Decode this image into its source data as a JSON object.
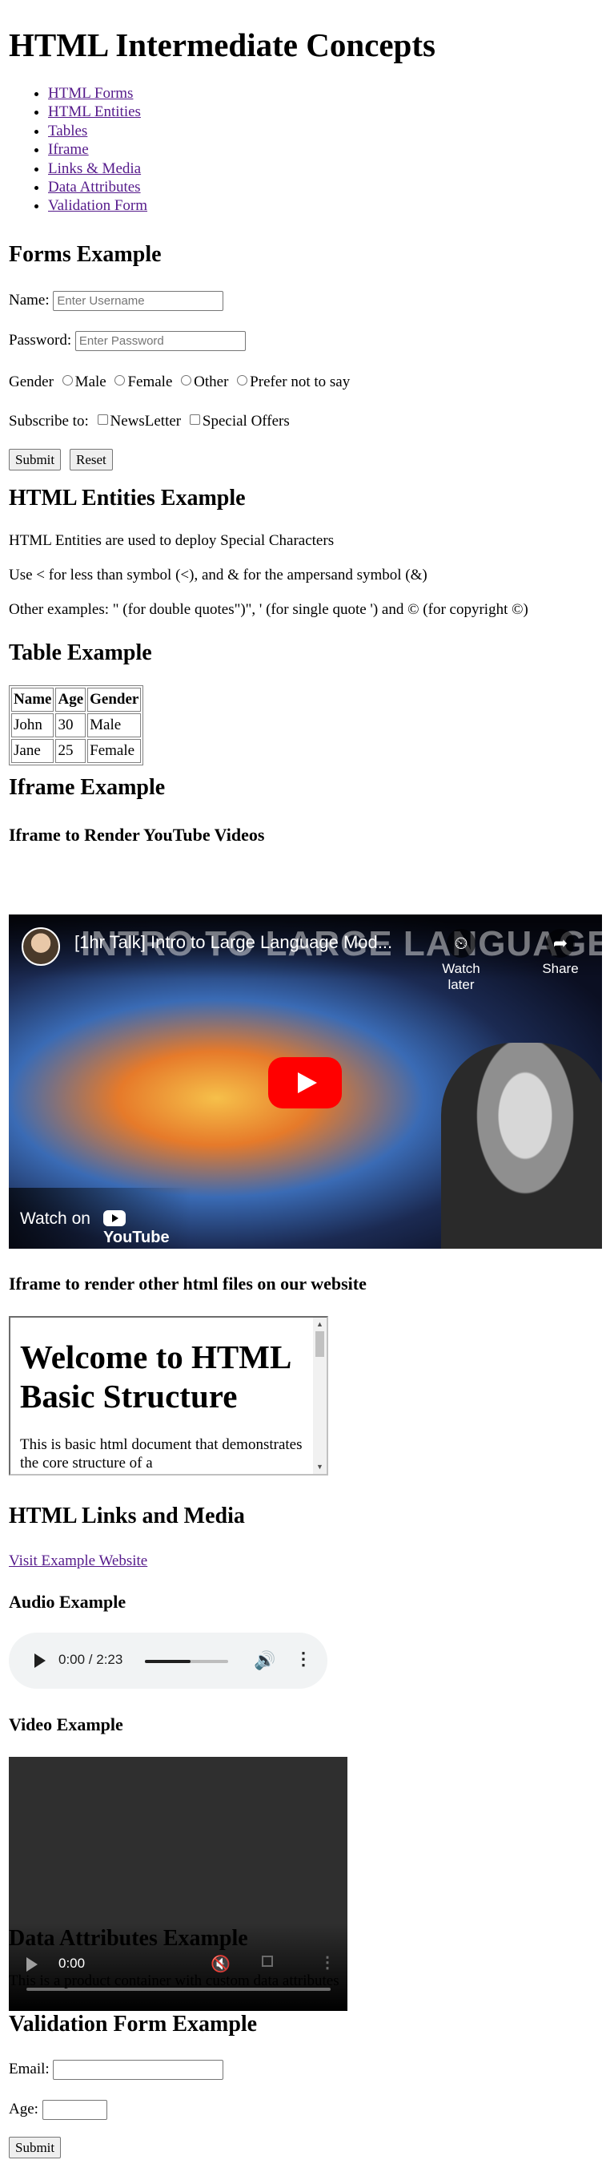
{
  "page_title": "HTML Intermediate Concepts",
  "nav": {
    "items": [
      {
        "label": "HTML Forms"
      },
      {
        "label": "HTML Entities"
      },
      {
        "label": "Tables"
      },
      {
        "label": "Iframe"
      },
      {
        "label": "Links & Media"
      },
      {
        "label": "Data Attributes"
      },
      {
        "label": "Validation Form"
      }
    ]
  },
  "forms": {
    "heading": "Forms Example",
    "name_label": "Name:",
    "name_placeholder": "Enter Username",
    "password_label": "Password:",
    "password_placeholder": "Enter Password",
    "gender_label": "Gender",
    "gender_options": [
      "Male",
      "Female",
      "Other",
      "Prefer not to say"
    ],
    "subscribe_label": "Subscribe to:",
    "subscribe_options": [
      "NewsLetter",
      "Special Offers"
    ],
    "submit_label": "Submit",
    "reset_label": "Reset"
  },
  "entities": {
    "heading": "HTML Entities Example",
    "line1": "HTML Entities are used to deploy Special Characters",
    "line2": "Use < for less than symbol (<), and & for the ampersand symbol (&)",
    "line3": "Other examples: \" (for double quotes\")\", ' (for single quote ') and © (for copyright ©)"
  },
  "table": {
    "heading": "Table Example",
    "headers": [
      "Name",
      "Age",
      "Gender"
    ],
    "rows": [
      [
        "John",
        "30",
        "Male"
      ],
      [
        "Jane",
        "25",
        "Female"
      ]
    ]
  },
  "iframe": {
    "heading": "Iframe Example",
    "youtube_subheading": "Iframe to Render YouTube Videos",
    "video_title": "[1hr Talk] Intro to Large Language Mod...",
    "video_banner": "INTRO TO LARGE LANGUAGE MODELS",
    "watch_later": "Watch later",
    "share": "Share",
    "watch_on": "Watch on",
    "youtube_logo": "YouTube",
    "local_subheading": "Iframe to render other html files on our website",
    "inner_heading": "Welcome to HTML Basic Structure",
    "inner_text": "This is basic html document that demonstrates the core structure of a"
  },
  "links_media": {
    "heading": "HTML Links and Media",
    "link_text": "Visit Example Website",
    "audio_heading": "Audio Example",
    "audio_time": "0:00 / 2:23",
    "audio_progress": 0.55,
    "video_heading": "Video Example",
    "video_time": "0:00"
  },
  "data_attributes": {
    "heading": "Data Attributes Example",
    "text": "This is a product container with custom data attributes"
  },
  "validation": {
    "heading": "Validation Form Example",
    "email_label": "Email:",
    "age_label": "Age:",
    "submit_label": "Submit"
  },
  "colors": {
    "link_visited": "#551a8b",
    "link_unvisited": "#0000ee",
    "youtube_red": "#ff0000",
    "audio_bg": "#f1f3f4"
  }
}
